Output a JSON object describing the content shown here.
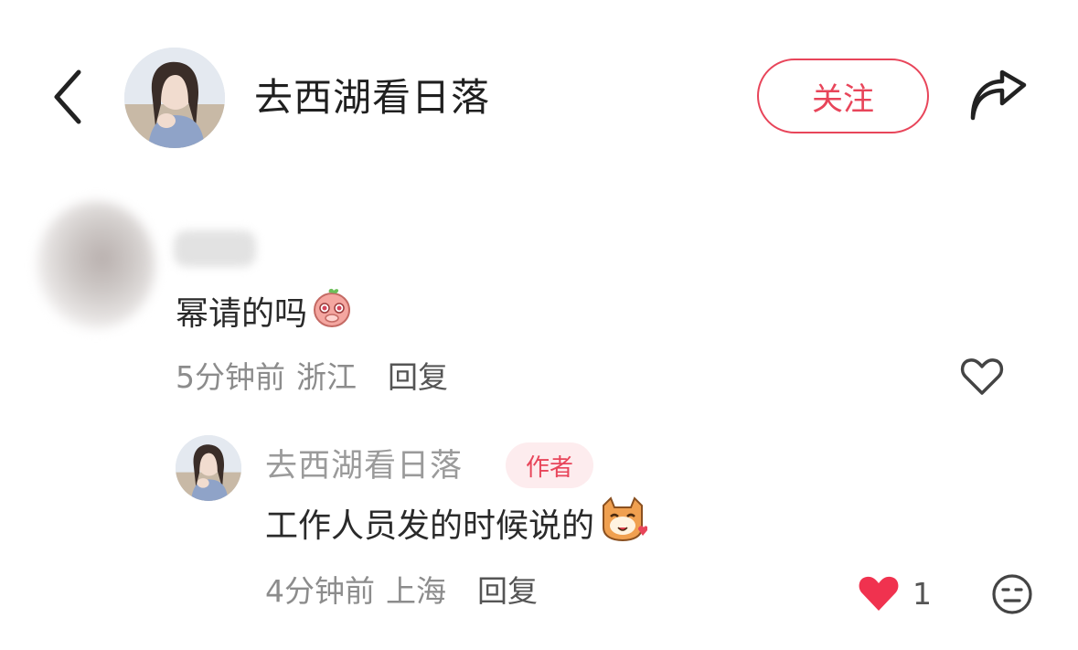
{
  "header": {
    "author_name": "去西湖看日落",
    "follow_label": "关注",
    "back_icon": "chevron-left-icon",
    "share_icon": "share-arrow-icon"
  },
  "comments": [
    {
      "text": "幂请的吗",
      "emoji": "pink-shy-face-emoji",
      "time": "5分钟前",
      "location": "浙江",
      "reply_label": "回复",
      "like_icon": "heart-outline-icon"
    }
  ],
  "reply": {
    "name": "去西湖看日落",
    "badge": "作者",
    "text": "工作人员发的时候说的",
    "emoji": "cat-heart-emoji",
    "time": "4分钟前",
    "location": "上海",
    "reply_label": "回复",
    "like_count": "1",
    "like_icon": "heart-filled-icon",
    "face_icon": "neutral-face-icon"
  },
  "colors": {
    "accent": "#e8455a",
    "meta_text": "#8c8c8c",
    "badge_bg": "#fdecee"
  }
}
